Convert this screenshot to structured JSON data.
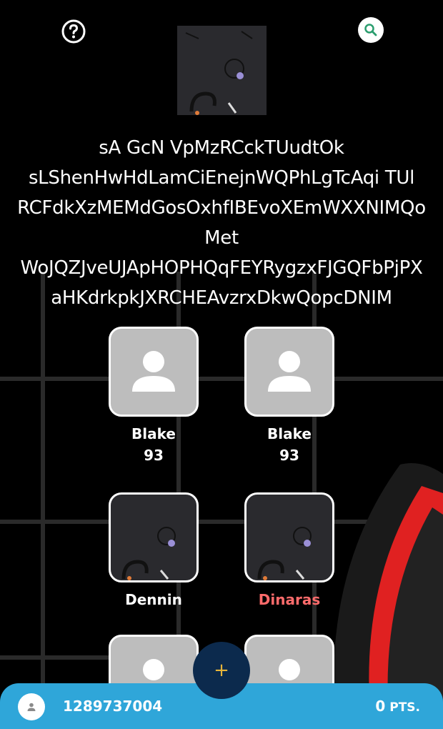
{
  "header": {
    "help_icon": "question-circle-icon",
    "search_icon": "search-icon"
  },
  "title": "sA GcN VpMzRCckTUudtOk\nsLShenHwHdLamCiEnejnWQPhLgTcAqi TUl\nRCFdkXzMEMdGosOxhfIBEvoXEmWXXNIMQo\nMet\nWoJQZJveUJApHOPHQqFEYRygzxFJGQFbPjPX\naHKdrkpkJXRCHEAvzrxDkwQopcDNIM",
  "cards": [
    {
      "name": "Blake",
      "score": "93",
      "thumb": "placeholder-user"
    },
    {
      "name": "Blake",
      "score": "93",
      "thumb": "placeholder-user"
    },
    {
      "name": "Dennin",
      "score": "",
      "thumb": "pattern-image"
    },
    {
      "name": "Dinaras",
      "score": "",
      "thumb": "pattern-image"
    },
    {
      "name": "",
      "score": "",
      "thumb": "placeholder-user"
    },
    {
      "name": "",
      "score": "",
      "thumb": "placeholder-user"
    }
  ],
  "fab": {
    "label": "+"
  },
  "bottom_bar": {
    "user_id": "1289737004",
    "points_value": "0",
    "points_unit": "PTS."
  },
  "colors": {
    "bottom_bar": "#2fa6d9",
    "fab_bg": "#0c2a4d",
    "fab_icon": "#e8b53a",
    "highlight_name": "#ff6b6b",
    "search_icon": "#2a9d6e"
  }
}
